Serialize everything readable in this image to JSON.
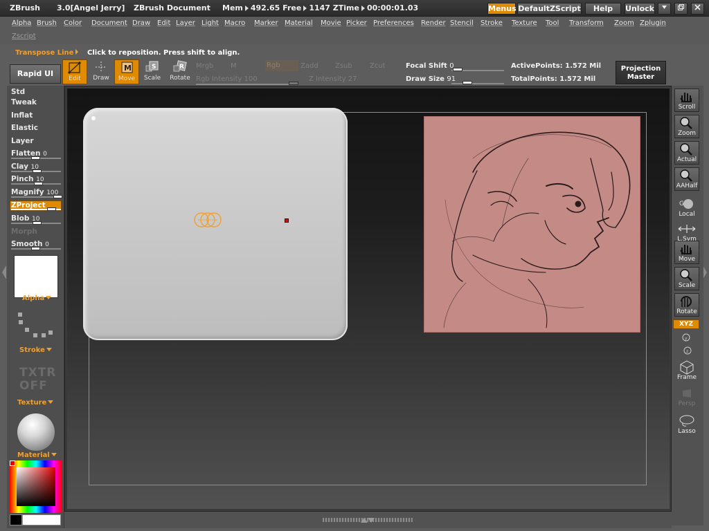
{
  "titlebar": {
    "app_name": "ZBrush",
    "version_user": "3.0[Angel Jerry]",
    "document": "ZBrush Document",
    "mem_label": "Mem",
    "mem_value": "492.65",
    "free_label": "Free",
    "free_value": "1147",
    "ztime_label": "ZTime",
    "ztime_value": "00:00:01.03",
    "buttons": {
      "menus": "Menus",
      "default_zscript": "DefaultZScript",
      "help": "Help",
      "unlock": "Unlock"
    }
  },
  "menus": [
    "Alpha",
    "Brush",
    "Color",
    "Document",
    "Draw",
    "Edit",
    "Layer",
    "Light",
    "Macro",
    "Marker",
    "Material",
    "Movie",
    "Picker",
    "Preferences",
    "Render",
    "Stencil",
    "Stroke",
    "Texture",
    "Tool",
    "Transform",
    "Zoom",
    "Zplugin",
    "Zscript"
  ],
  "info": {
    "mode": "Transpose Line",
    "message": "Click to reposition. Press shift to align."
  },
  "toolbar": {
    "rapid_ui": "Rapid UI",
    "edit": "Edit",
    "draw": "Draw",
    "move": "Move",
    "scale": "Scale",
    "rotate": "Rotate",
    "mrgb": "Mrgb",
    "m": "M",
    "rgb": "Rgb",
    "zadd": "Zadd",
    "zsub": "Zsub",
    "zcut": "Zcut",
    "rgb_intensity": "Rgb Intensity 100",
    "z_intensity": "Z Intensity 27",
    "focal_shift_label": "Focal Shift",
    "focal_shift_value": "0",
    "draw_size_label": "Draw Size",
    "draw_size_value": "91",
    "active_points": "ActivePoints: 1.572 Mil",
    "total_points": "TotalPoints: 1.572 Mil",
    "projection_master_1": "Projection",
    "projection_master_2": "Master"
  },
  "left_panel": {
    "brushes": [
      "Std",
      "Tweak",
      "Inflat",
      "Elastic",
      "Layer"
    ],
    "flatten": {
      "label": "Flatten",
      "value": "0"
    },
    "clay": {
      "label": "Clay",
      "value": "10"
    },
    "pinch": {
      "label": "Pinch",
      "value": "10"
    },
    "magnify": {
      "label": "Magnify",
      "value": "100"
    },
    "zproject": "ZProject",
    "blob": {
      "label": "Blob",
      "value": "10"
    },
    "morph": "Morph",
    "smooth": {
      "label": "Smooth",
      "value": "0"
    },
    "alpha": "Alpha",
    "stroke": "Stroke",
    "txtr_1": "TXTR",
    "txtr_2": "OFF",
    "texture": "Texture",
    "material": "Material"
  },
  "right_panel": {
    "scroll": "Scroll",
    "zoom": "Zoom",
    "actual": "Actual",
    "aahalf": "AAHalf",
    "local": "Local",
    "lsym": "L.Sym",
    "move": "Move",
    "scale": "Scale",
    "rotate": "Rotate",
    "xyz": "XYZ",
    "frame": "Frame",
    "persp": "Persp",
    "lasso": "Lasso"
  },
  "colors": {
    "accent": "#e08a00",
    "accent_text": "#f0a030",
    "reference_bg": "#c38a86"
  }
}
